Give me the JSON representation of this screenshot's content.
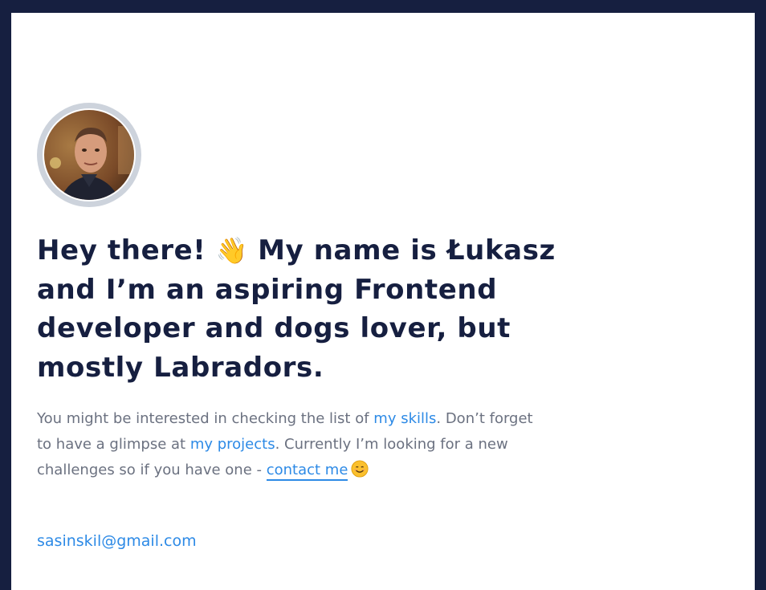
{
  "profile": {
    "avatar_alt": "profile photo"
  },
  "headline": {
    "part1": "Hey there!",
    "wave_emoji": "👋",
    "part2": "My name is Łukasz",
    "line2": "and I’m an aspiring Frontend",
    "line3": "developer and dogs lover, but",
    "line4": "mostly Labradors."
  },
  "intro": {
    "text1": "You might be interested in checking the list of ",
    "skills_link": "my skills",
    "text2": ". Don’t forget to have a glimpse at ",
    "projects_link": "my projects",
    "text3": ". Currently I’m looking for a new challenges so if you have one - ",
    "contact_link": "contact me",
    "smile_icon": "smiling-face-icon"
  },
  "email": "sasinskil@gmail.com",
  "colors": {
    "frame": "#161f40",
    "heading": "#161f40",
    "body_text": "#6b7180",
    "link": "#2d8ae6",
    "avatar_ring": "#cdd3dc"
  }
}
